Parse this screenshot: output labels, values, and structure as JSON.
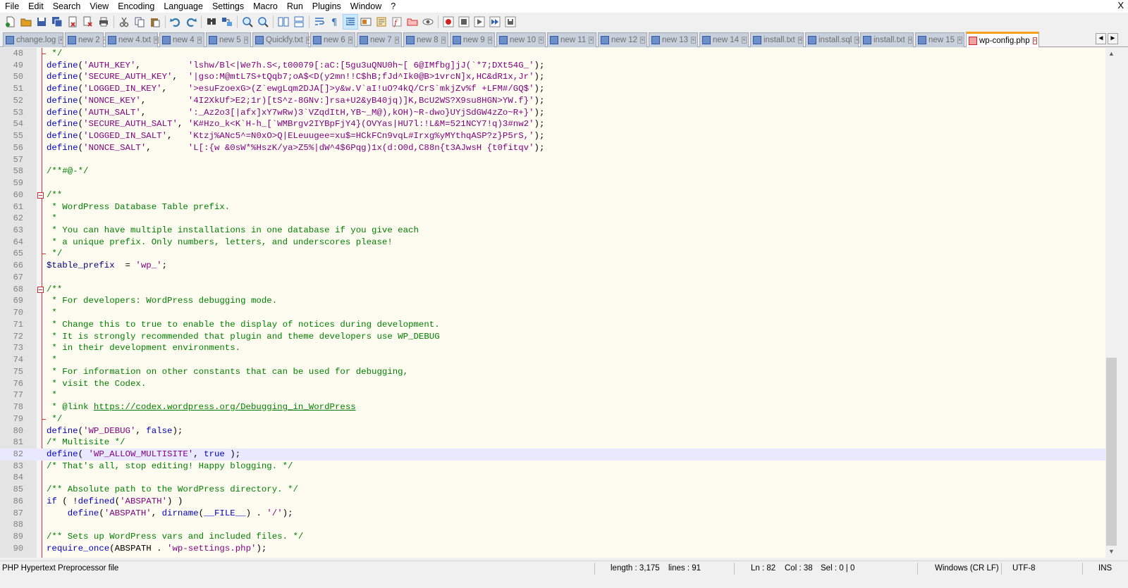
{
  "menu": [
    "File",
    "Edit",
    "Search",
    "View",
    "Encoding",
    "Language",
    "Settings",
    "Macro",
    "Run",
    "Plugins",
    "Window",
    "?"
  ],
  "window_close": "X",
  "toolbar": [
    {
      "name": "new-file-icon",
      "color": "#2d8c2d"
    },
    {
      "name": "open-file-icon",
      "color": "#e0a020"
    },
    {
      "name": "save-icon",
      "color": "#3a5fa8"
    },
    {
      "name": "save-all-icon",
      "color": "#3a5fa8"
    },
    {
      "name": "close-icon",
      "color": "#c83030"
    },
    {
      "name": "close-all-icon",
      "color": "#c83030"
    },
    {
      "name": "print-icon",
      "color": "#505050"
    },
    {
      "name": "sep"
    },
    {
      "name": "cut-icon",
      "color": "#606060"
    },
    {
      "name": "copy-icon",
      "color": "#506080"
    },
    {
      "name": "paste-icon",
      "color": "#a07030"
    },
    {
      "name": "sep"
    },
    {
      "name": "undo-icon",
      "color": "#2d7ab0"
    },
    {
      "name": "redo-icon",
      "color": "#2d7ab0"
    },
    {
      "name": "sep"
    },
    {
      "name": "find-icon",
      "color": "#404040"
    },
    {
      "name": "replace-icon",
      "color": "#3060b0"
    },
    {
      "name": "sep"
    },
    {
      "name": "zoom-in-icon",
      "color": "#3070c0"
    },
    {
      "name": "zoom-out-icon",
      "color": "#3070c0"
    },
    {
      "name": "sep"
    },
    {
      "name": "sync-vertical-icon",
      "color": "#3070c0"
    },
    {
      "name": "sync-horizontal-icon",
      "color": "#3070c0"
    },
    {
      "name": "sep"
    },
    {
      "name": "word-wrap-icon",
      "color": "#3070c0"
    },
    {
      "name": "show-all-chars-icon",
      "color": "#3070c0"
    },
    {
      "name": "indent-guide-icon",
      "color": "#3070c0",
      "active": true
    },
    {
      "name": "user-lang-icon",
      "color": "#d08020"
    },
    {
      "name": "doc-map-icon",
      "color": "#b08020"
    },
    {
      "name": "function-list-icon",
      "color": "#c83030"
    },
    {
      "name": "folder-workspace-icon",
      "color": "#c83030"
    },
    {
      "name": "monitoring-icon",
      "color": "#606060"
    },
    {
      "name": "sep"
    },
    {
      "name": "record-macro-icon",
      "color": "#d02020"
    },
    {
      "name": "stop-macro-icon",
      "color": "#606060"
    },
    {
      "name": "play-macro-icon",
      "color": "#606060"
    },
    {
      "name": "play-macro-multiple-icon",
      "color": "#3060b0"
    },
    {
      "name": "save-macro-icon",
      "color": "#606060"
    }
  ],
  "tabs": [
    {
      "label": "change.log",
      "width": 86
    },
    {
      "label": "new 2",
      "width": 55
    },
    {
      "label": "new 4.txt",
      "width": 75
    },
    {
      "label": "new 4",
      "width": 64
    },
    {
      "label": "new 5",
      "width": 64
    },
    {
      "label": "Quickfy.txt",
      "width": 80
    },
    {
      "label": "new 6",
      "width": 64
    },
    {
      "label": "new 7",
      "width": 64
    },
    {
      "label": "new 8",
      "width": 64
    },
    {
      "label": "new 9",
      "width": 64
    },
    {
      "label": "new 10",
      "width": 70
    },
    {
      "label": "new 11",
      "width": 70
    },
    {
      "label": "new 12",
      "width": 70
    },
    {
      "label": "new 13",
      "width": 70
    },
    {
      "label": "new 14",
      "width": 70
    },
    {
      "label": "install.txt",
      "width": 76
    },
    {
      "label": "install.sql",
      "width": 76
    },
    {
      "label": "install.txt",
      "width": 76
    },
    {
      "label": "new 15",
      "width": 70
    },
    {
      "label": "wp-config.php",
      "width": 104,
      "current": true
    }
  ],
  "tab_scroll": {
    "left": "◄",
    "right": "►"
  },
  "code_lines": [
    {
      "n": "48",
      "html": "<span class='cm'> */</span>",
      "fold": "end"
    },
    {
      "n": "49",
      "html": "<span class='kw'>define</span>(<span class='str'>'AUTH_KEY'</span>,         <span class='str'>'lshw/Bl&lt;|We7h.S&lt;,t00079[:aC:[5gu3uQNU0h~[ 6@IMfbg]jJ(`*7;DXt54G_'</span>);"
    },
    {
      "n": "50",
      "html": "<span class='kw'>define</span>(<span class='str'>'SECURE_AUTH_KEY'</span>,  <span class='str'>'|gso:M@mtL7S+tQqb7;oA$&lt;D(y2mn!!C$hB;fJd^Ik0@B&gt;1vrcN]x,HC&amp;dR1x,Jr'</span>);"
    },
    {
      "n": "51",
      "html": "<span class='kw'>define</span>(<span class='str'>'LOGGED_IN_KEY'</span>,    <span class='str'>'&gt;esuFzoexG&gt;(Z`ewgLqm2DJA[]&gt;y&amp;w.V`aI!uO?4kQ/CrS`mkjZv%f +LFM#/GQ$'</span>);"
    },
    {
      "n": "52",
      "html": "<span class='kw'>define</span>(<span class='str'>'NONCE_KEY'</span>,        <span class='str'>'4I2XkUf&gt;E2;1r)[tS^z-8GNv:]rsa+U2&amp;yB40jq)]K,BcU2WS?X9su8HGN&gt;YW.f}'</span>);"
    },
    {
      "n": "53",
      "html": "<span class='kw'>define</span>(<span class='str'>'AUTH_SALT'</span>,        <span class='str'>':_Az2o3[|afx]xY7wRw)3`VZqdItH,YB~_M@),kOH)~R-dwo}UYjSdGW4zZo~R+}'</span>);"
    },
    {
      "n": "54",
      "html": "<span class='kw'>define</span>(<span class='str'>'SECURE_AUTH_SALT'</span>, <span class='str'>'K#Hzo_k&lt;K`H-h_[`WMBrgv2IYBpFjY4}(OVYas|HU7l:!L&amp;M=521NCY7!q)3#nw2'</span>);"
    },
    {
      "n": "55",
      "html": "<span class='kw'>define</span>(<span class='str'>'LOGGED_IN_SALT'</span>,   <span class='str'>'Ktzj%ANc5^=N0xO&gt;Q|ELeuugee=xu$=HCkFCn9vqL#Irxg%yMYthqASP?z}P5rS,'</span>);"
    },
    {
      "n": "56",
      "html": "<span class='kw'>define</span>(<span class='str'>'NONCE_SALT'</span>,       <span class='str'>'L[:{w &amp;0sW*%HszK/ya&gt;Z5%|dW^4$6Pqg)1x(d:O0d,C88n{t3AJwsH {t0fitqv'</span>);"
    },
    {
      "n": "57",
      "html": ""
    },
    {
      "n": "58",
      "html": "<span class='cm'>/**#@-*/</span>"
    },
    {
      "n": "59",
      "html": ""
    },
    {
      "n": "60",
      "html": "<span class='cm'>/**</span>",
      "fold": "start"
    },
    {
      "n": "61",
      "html": "<span class='cm'> * WordPress Database Table prefix.</span>"
    },
    {
      "n": "62",
      "html": "<span class='cm'> *</span>"
    },
    {
      "n": "63",
      "html": "<span class='cm'> * You can have multiple installations in one database if you give each</span>"
    },
    {
      "n": "64",
      "html": "<span class='cm'> * a unique prefix. Only numbers, letters, and underscores please!</span>"
    },
    {
      "n": "65",
      "html": "<span class='cm'> */</span>",
      "fold": "end"
    },
    {
      "n": "66",
      "html": "<span class='var'>$table_prefix</span>  = <span class='str'>'wp_'</span>;"
    },
    {
      "n": "67",
      "html": ""
    },
    {
      "n": "68",
      "html": "<span class='cm'>/**</span>",
      "fold": "start"
    },
    {
      "n": "69",
      "html": "<span class='cm'> * For developers: WordPress debugging mode.</span>"
    },
    {
      "n": "70",
      "html": "<span class='cm'> *</span>"
    },
    {
      "n": "71",
      "html": "<span class='cm'> * Change this to true to enable the display of notices during development.</span>"
    },
    {
      "n": "72",
      "html": "<span class='cm'> * It is strongly recommended that plugin and theme developers use WP_DEBUG</span>"
    },
    {
      "n": "73",
      "html": "<span class='cm'> * in their development environments.</span>"
    },
    {
      "n": "74",
      "html": "<span class='cm'> *</span>"
    },
    {
      "n": "75",
      "html": "<span class='cm'> * For information on other constants that can be used for debugging,</span>"
    },
    {
      "n": "76",
      "html": "<span class='cm'> * visit the Codex.</span>"
    },
    {
      "n": "77",
      "html": "<span class='cm'> *</span>"
    },
    {
      "n": "78",
      "html": "<span class='cm'> * @link <span class='ul'>https://codex.wordpress.org/Debugging_in_WordPress</span></span>"
    },
    {
      "n": "79",
      "html": "<span class='cm'> */</span>",
      "fold": "end"
    },
    {
      "n": "80",
      "html": "<span class='kw'>define</span>(<span class='str'>'WP_DEBUG'</span>, <span class='kw'>false</span>);"
    },
    {
      "n": "81",
      "html": "<span class='cm'>/* Multisite */</span>"
    },
    {
      "n": "82",
      "html": "<span class='kw'>define</span>( <span class='str'>'WP_ALLOW_MULTISITE'</span>, <span class='kw'>true</span> );",
      "current": true
    },
    {
      "n": "83",
      "html": "<span class='cm'>/* That's all, stop editing! Happy blogging. */</span>"
    },
    {
      "n": "84",
      "html": ""
    },
    {
      "n": "85",
      "html": "<span class='cm'>/** Absolute path to the WordPress directory. */</span>"
    },
    {
      "n": "86",
      "html": "<span class='kw'>if</span> ( !<span class='kw'>defined</span>(<span class='str'>'ABSPATH'</span>) )"
    },
    {
      "n": "87",
      "html": "    <span class='kw'>define</span>(<span class='str'>'ABSPATH'</span>, <span class='kw'>dirname</span>(<span class='kw'>__FILE__</span>) . <span class='str'>'/'</span>);"
    },
    {
      "n": "88",
      "html": ""
    },
    {
      "n": "89",
      "html": "<span class='cm'>/** Sets up WordPress vars and included files. */</span>"
    },
    {
      "n": "90",
      "html": "<span class='kw'>require_once</span>(ABSPATH . <span class='str'>'wp-settings.php'</span>);"
    }
  ],
  "scrollbar": {
    "up": "▲",
    "down": "▼"
  },
  "status": {
    "file_type": "PHP Hypertext Preprocessor file",
    "length": "length : 3,175",
    "lines": "lines : 91",
    "ln": "Ln : 82",
    "col": "Col : 38",
    "sel": "Sel : 0 | 0",
    "eol": "Windows (CR LF)",
    "encoding": "UTF-8",
    "mode": "INS"
  }
}
